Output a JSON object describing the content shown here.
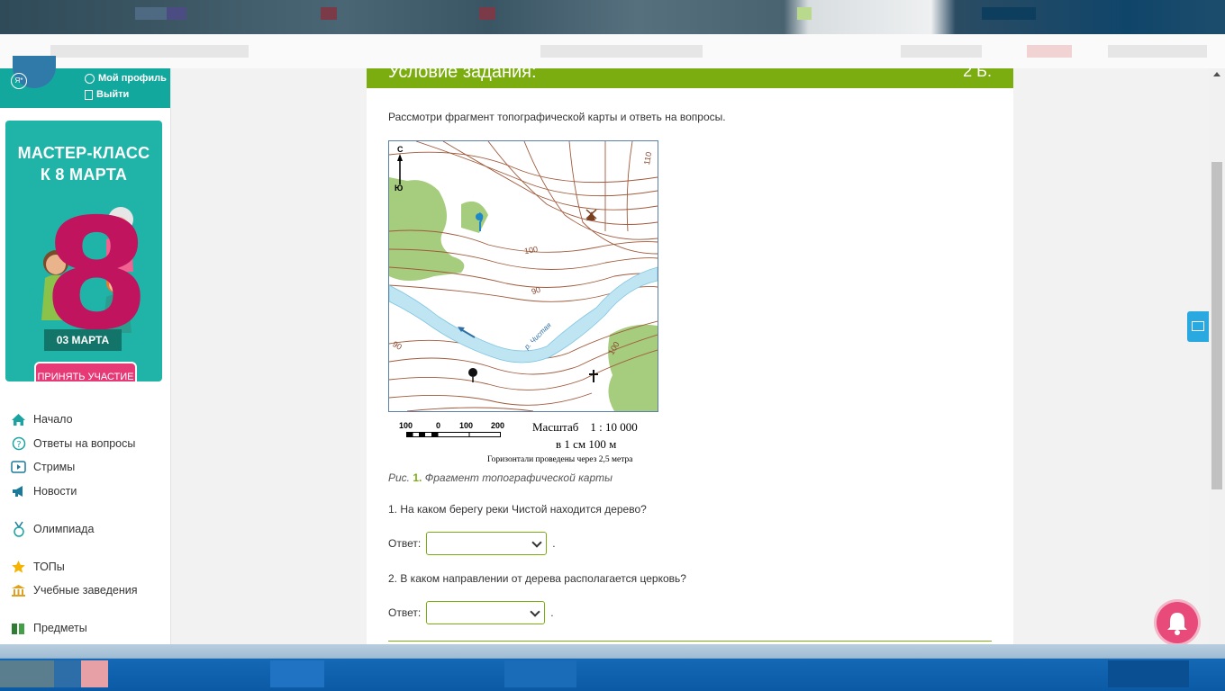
{
  "sidebar": {
    "profile": {
      "badge": "Я*",
      "my_profile": "Мой профиль",
      "logout": "Выйти"
    },
    "promo": {
      "title_line1": "МАСТЕР-КЛАСС",
      "title_line2": "К 8 МАРТА",
      "number": "8",
      "date": "03 МАРТА",
      "button": "ПРИНЯТЬ УЧАСТИЕ"
    },
    "nav": [
      {
        "label": "Начало",
        "icon": "home-icon"
      },
      {
        "label": "Ответы на вопросы",
        "icon": "question-icon"
      },
      {
        "label": "Стримы",
        "icon": "play-icon"
      },
      {
        "label": "Новости",
        "icon": "megaphone-icon"
      },
      {
        "label": "Олимпиада",
        "icon": "medal-icon"
      },
      {
        "label": "ТОПы",
        "icon": "star-icon"
      },
      {
        "label": "Учебные заведения",
        "icon": "building-icon"
      },
      {
        "label": "Предметы",
        "icon": "books-icon"
      }
    ]
  },
  "task": {
    "header_title": "Условие задания:",
    "points": "2 Б.",
    "instruction": "Рассмотри фрагмент топографической карты и ответь на вопросы.",
    "map": {
      "north": "С",
      "south": "Ю",
      "river": "р. Чистая",
      "contours": [
        "110",
        "100",
        "90",
        "90",
        "100"
      ],
      "scale_ticks": [
        "100",
        "0",
        "100",
        "200"
      ],
      "scale": "Масштаб    1 : 10 000",
      "scale_cm": "в 1 см 100 м",
      "contour_note": "Горизонтали проведены через 2,5 метра"
    },
    "caption_prefix": "Рис.",
    "caption_number": "1.",
    "caption_text": "Фрагмент топографической карты",
    "q1": "1. На каком берегу реки Чистой находится дерево?",
    "q2": "2. В каком направлении от дерева располагается церковь?",
    "answer_label": "Ответ:",
    "answer_suffix": ".",
    "answer1_value": "",
    "answer2_value": ""
  },
  "colors": {
    "accent": "#7cad10",
    "teal": "#13a89e",
    "promo_pink": "#e63a77",
    "bell": "#e84a7a"
  }
}
